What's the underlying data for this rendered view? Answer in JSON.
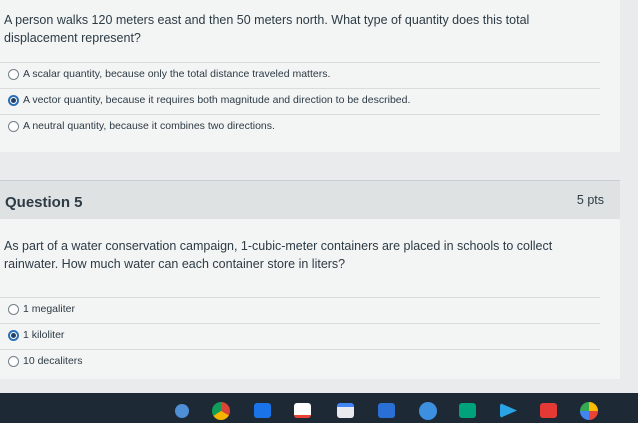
{
  "q4": {
    "text": "A person walks 120 meters east and then 50 meters north. What type of quantity does this total displacement represent?",
    "answers": [
      {
        "label": "A scalar quantity, because only the total distance traveled matters.",
        "selected": false
      },
      {
        "label": "A vector quantity, because it requires both magnitude and direction to be described.",
        "selected": true
      },
      {
        "label": "A neutral quantity, because it combines two directions.",
        "selected": false
      }
    ]
  },
  "q5": {
    "title": "Question 5",
    "points": "5 pts",
    "text": "As part of a water conservation campaign, 1-cubic-meter containers are placed in schools to collect rainwater. How much water can each container store in liters?",
    "answers": [
      {
        "label": "1 megaliter",
        "selected": false
      },
      {
        "label": "1 kiloliter",
        "selected": true
      },
      {
        "label": "10 decaliters",
        "selected": false
      }
    ]
  },
  "taskbar": {
    "icons": [
      "launcher-icon",
      "chrome-icon",
      "apps-icon",
      "gmail-icon",
      "calendar-icon",
      "files-icon",
      "chat-icon",
      "meet-icon",
      "play-store-icon",
      "youtube-icon",
      "photos-icon"
    ],
    "colors": {
      "bar": "#1d2a35",
      "accent": "#2b6fb5"
    }
  }
}
